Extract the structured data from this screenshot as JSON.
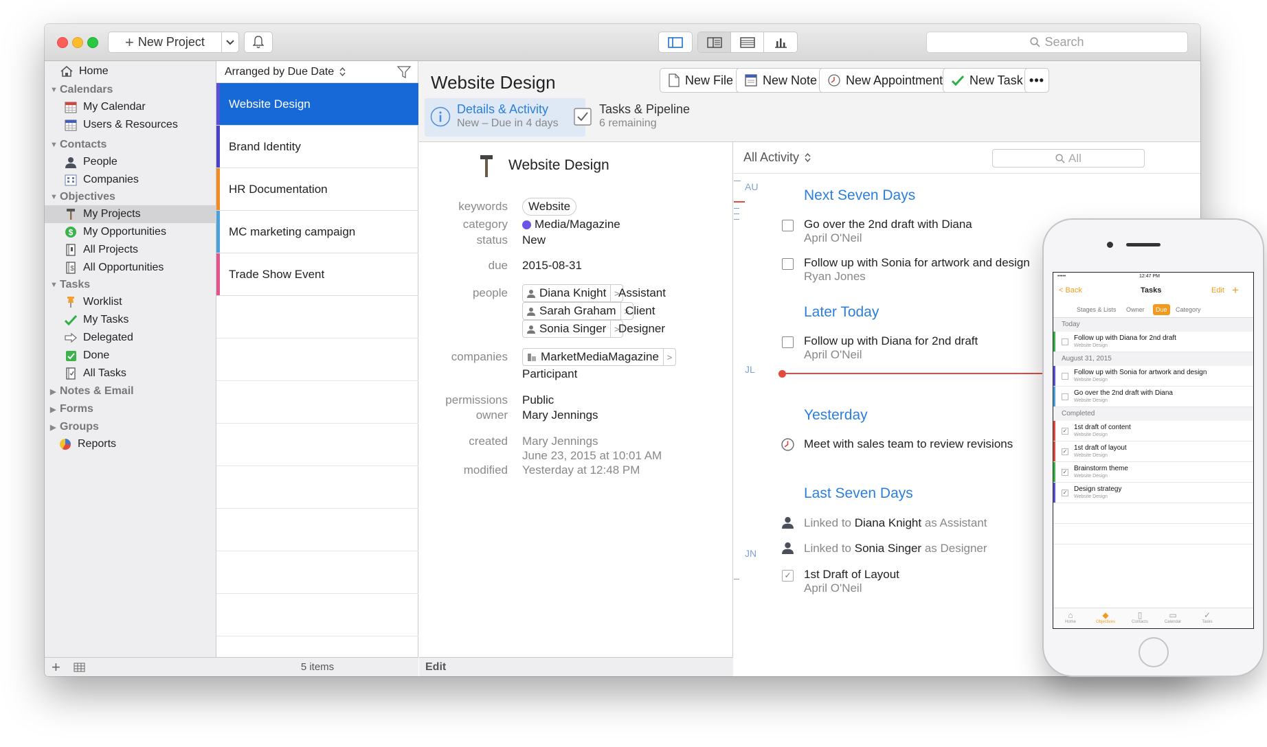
{
  "toolbar": {
    "new_project": "New Project",
    "search_placeholder": "Search"
  },
  "sidebar": {
    "home": "Home",
    "calendars": "Calendars",
    "my_calendar": "My Calendar",
    "users_resources": "Users & Resources",
    "contacts": "Contacts",
    "people": "People",
    "companies": "Companies",
    "objectives": "Objectives",
    "my_projects": "My Projects",
    "my_opportunities": "My Opportunities",
    "all_projects": "All Projects",
    "all_opportunities": "All Opportunities",
    "tasks": "Tasks",
    "worklist": "Worklist",
    "my_tasks": "My Tasks",
    "delegated": "Delegated",
    "done": "Done",
    "all_tasks": "All Tasks",
    "notes_email": "Notes & Email",
    "forms": "Forms",
    "groups": "Groups",
    "reports": "Reports"
  },
  "list": {
    "arranged": "Arranged by Due Date",
    "items": [
      {
        "label": "Website Design",
        "color": "#5b4fd6"
      },
      {
        "label": "Brand Identity",
        "color": "#4a41c8"
      },
      {
        "label": "HR Documentation",
        "color": "#f08a24"
      },
      {
        "label": "MC marketing campaign",
        "color": "#4aa1db"
      },
      {
        "label": "Trade Show Event",
        "color": "#e2558c"
      }
    ],
    "count": "5 items"
  },
  "detail": {
    "title": "Website Design",
    "new_file": "New File",
    "new_note": "New Note",
    "new_appointment": "New Appointment",
    "new_task": "New Task",
    "tab1_title": "Details & Activity",
    "tab1_sub": "New – Due in 4 days",
    "tab2_title": "Tasks & Pipeline",
    "tab2_sub": "6 remaining",
    "name": "Website Design",
    "keywords_label": "keywords",
    "keywords": "Website",
    "category_label": "category",
    "category": "Media/Magazine",
    "status_label": "status",
    "status": "New",
    "due_label": "due",
    "due": "2015-08-31",
    "people_label": "people",
    "person1": "Diana Knight",
    "role1": "Assistant",
    "person2": "Sarah Graham",
    "role2": "Client",
    "person3": "Sonia Singer",
    "role3": "Designer",
    "companies_label": "companies",
    "company": "MarketMediaMagazine",
    "company_role": "Participant",
    "permissions_label": "permissions",
    "permissions": "Public",
    "owner_label": "owner",
    "owner": "Mary Jennings",
    "created_label": "created",
    "created_by": "Mary Jennings",
    "created_at": "June 23, 2015 at 10:01 AM",
    "modified_label": "modified",
    "modified": "Yesterday at 12:48 PM",
    "edit": "Edit"
  },
  "activity": {
    "filter": "All Activity",
    "search_placeholder": "All",
    "month_au": "AU",
    "month_jl": "JL",
    "month_jn": "JN",
    "sec1": "Next Seven Days",
    "item1": "Go over the 2nd draft with Diana",
    "item1_sub": "April O'Neil",
    "item2": "Follow up with Sonia for artwork and design",
    "item2_sub": "Ryan Jones",
    "sec2": "Later Today",
    "item3": "Follow up with Diana for 2nd draft",
    "item3_sub": "April O'Neil",
    "sec3": "Yesterday",
    "item4": "Meet with sales team to review revisions",
    "sec4": "Last Seven Days",
    "link1_a": "Linked to",
    "link1_b": "Diana Knight",
    "link1_c": "as Assistant",
    "link2_a": "Linked to",
    "link2_b": "Sonia Singer",
    "link2_c": "as Designer",
    "item5": "1st Draft of Layout",
    "item5_sub": "April O'Neil"
  },
  "phone": {
    "time": "12:47 PM",
    "back": "Back",
    "title": "Tasks",
    "edit": "Edit",
    "seg1": "Stages & Lists",
    "seg2": "Owner",
    "seg3": "Due",
    "seg4": "Category",
    "today": "Today",
    "t1": "Follow up with Diana for 2nd draft",
    "t_sub": "Website Design",
    "aug": "August 31, 2015",
    "t2": "Follow up with Sonia for artwork and design",
    "t3": "Go over the 2nd draft with Diana",
    "completed": "Completed",
    "c1": "1st draft of content",
    "c2": "1st draft of layout",
    "c3": "Brainstorm theme",
    "c4": "Design strategy",
    "tab_home": "Home",
    "tab_objectives": "Objectives",
    "tab_contacts": "Contacts",
    "tab_calendar": "Calendar",
    "tab_tasks": "Tasks"
  },
  "colors": {
    "accent": "#1769d8",
    "link_blue": "#2b7fdc",
    "phone_orange": "#f39a1e"
  }
}
